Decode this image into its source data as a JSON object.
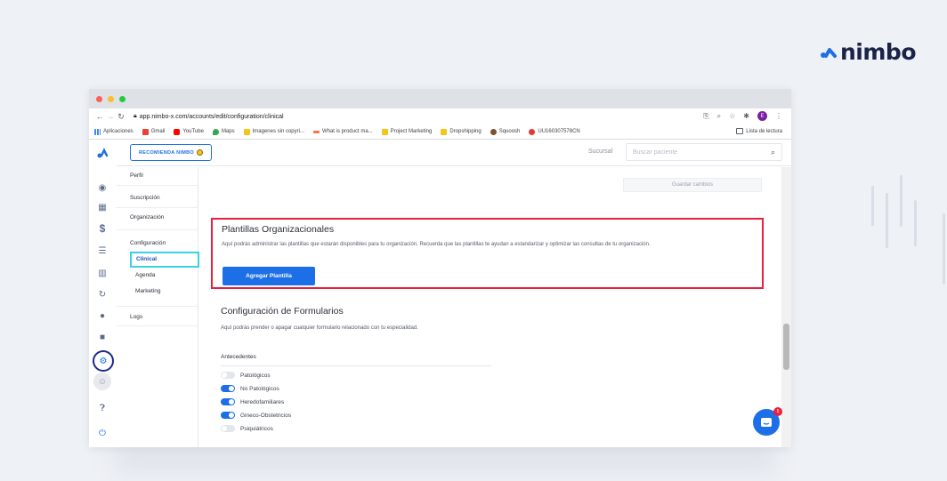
{
  "brand": {
    "name": "nimbo",
    "accent": "#1d6fe8",
    "dark": "#1b2347"
  },
  "browser": {
    "url": "app.nimbo-x.com/accounts/edit/configuration/clinical",
    "profile_initial": "E",
    "bookmarks": [
      {
        "label": "Aplicaciones",
        "icon": "apps-icon"
      },
      {
        "label": "Gmail",
        "icon": "gmail-icon"
      },
      {
        "label": "YouTube",
        "icon": "youtube-icon"
      },
      {
        "label": "Maps",
        "icon": "maps-icon"
      },
      {
        "label": "Imagenes sin copyri...",
        "icon": "folder-icon"
      },
      {
        "label": "What is product ma...",
        "icon": "link-icon"
      },
      {
        "label": "Project Marketing",
        "icon": "folder-icon"
      },
      {
        "label": "Dropshipping",
        "icon": "folder-icon"
      },
      {
        "label": "Squoosh",
        "icon": "squoosh-icon"
      },
      {
        "label": "UU160307578CN",
        "icon": "location-icon"
      }
    ],
    "reading_list": "Lista de lectura"
  },
  "topbar": {
    "recommend_label": "RECOMIENDA NIMBO",
    "branch_label": "Sucursal",
    "search_placeholder": "Buscar paciente"
  },
  "subnav": {
    "perfil": "Perfil",
    "suscripcion": "Suscripción",
    "organizacion": "Organización",
    "configuracion": "Configuración",
    "clinical": "Clinical",
    "agenda": "Agenda",
    "marketing": "Marketing",
    "logs": "Logs"
  },
  "main": {
    "save_label": "Guardar cambios",
    "templates": {
      "title": "Plantillas Organizacionales",
      "description": "Aquí podrás administrar las plantillas que estarán disponibles para tu organización. Recuerda que las plantillas te ayudan a estandarizar y optimizar las consultas de tu organización.",
      "button": "Agregar Plantilla"
    },
    "forms": {
      "title": "Configuración de Formularios",
      "description": "Aquí podrás prender o apagar cualquier formulario relacionado con tu especialidad.",
      "section": "Antecedentes",
      "toggles": [
        {
          "label": "Patológicos",
          "on": false
        },
        {
          "label": "No Patológicos",
          "on": true
        },
        {
          "label": "Heredofamiliares",
          "on": true
        },
        {
          "label": "Gineco-Obstetricios",
          "on": true
        },
        {
          "label": "Psiquiátricos",
          "on": false
        }
      ]
    }
  },
  "chat_badge": "5"
}
